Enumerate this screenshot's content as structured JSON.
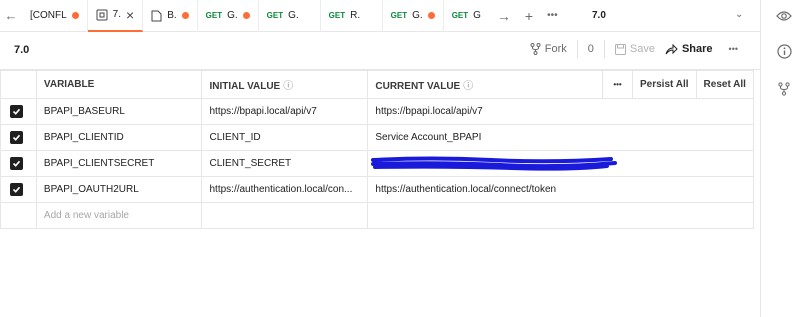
{
  "tabbar": {
    "back_icon": "arrow-left-icon",
    "tabs": [
      {
        "label": "[CONFL",
        "method": "",
        "icon": "",
        "dirty": true,
        "active": false
      },
      {
        "label": "7.",
        "method": "",
        "icon": "environment-icon",
        "dirty": false,
        "active": true,
        "closable": true
      },
      {
        "label": "B.",
        "method": "",
        "icon": "document-icon",
        "dirty": true,
        "active": false
      },
      {
        "label": "G.",
        "method": "GET",
        "icon": "",
        "dirty": true,
        "active": false
      },
      {
        "label": "G.",
        "method": "GET",
        "icon": "",
        "dirty": false,
        "active": false
      },
      {
        "label": "R.",
        "method": "GET",
        "icon": "",
        "dirty": false,
        "active": false
      },
      {
        "label": "G.",
        "method": "GET",
        "icon": "",
        "dirty": true,
        "active": false
      },
      {
        "label": "G",
        "method": "GET",
        "icon": "",
        "dirty": false,
        "active": false
      }
    ],
    "environment_selector": "7.0"
  },
  "header": {
    "title": "7.0",
    "fork_label": "Fork",
    "fork_count": "0",
    "save_label": "Save",
    "share_label": "Share"
  },
  "table": {
    "columns": {
      "variable": "VARIABLE",
      "initial_value": "INITIAL VALUE",
      "current_value": "CURRENT VALUE",
      "persist_all": "Persist All",
      "reset_all": "Reset All"
    },
    "rows": [
      {
        "enabled": true,
        "variable": "BPAPI_BASEURL",
        "initial": "https://bpapi.local/api/v7",
        "current": "https://bpapi.local/api/v7"
      },
      {
        "enabled": true,
        "variable": "BPAPI_CLIENTID",
        "initial": "CLIENT_ID",
        "current": "Service Account_BPAPI"
      },
      {
        "enabled": true,
        "variable": "BPAPI_CLIENTSECRET",
        "initial": "CLIENT_SECRET",
        "current": "",
        "redacted": true
      },
      {
        "enabled": true,
        "variable": "BPAPI_OAUTH2URL",
        "initial": "https://authentication.local/con...",
        "current": "https://authentication.local/connect/token"
      }
    ],
    "add_placeholder": "Add a new variable"
  },
  "right_rail": {
    "icons": [
      "eye-icon",
      "info-icon",
      "fork-icon"
    ]
  },
  "colors": {
    "accent": "#ff6c37",
    "get_method": "#0b8a3a",
    "redaction": "#1a1adb"
  }
}
